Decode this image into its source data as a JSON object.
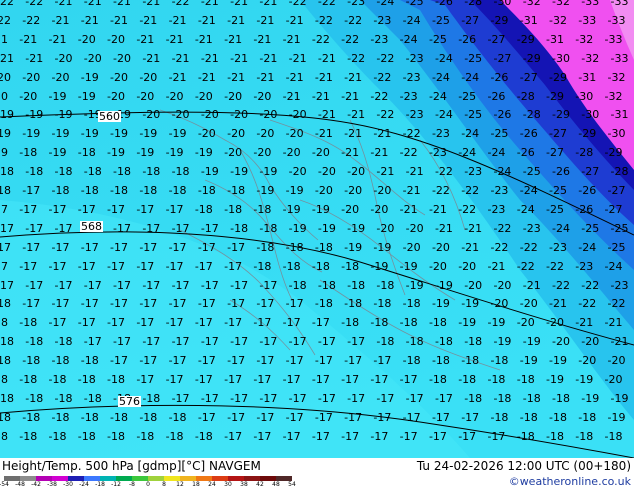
{
  "map": {
    "contour_labels": [
      "560",
      "568",
      "576"
    ],
    "temperature_field_rows": [
      "-22 -22 -21 -21 -21 -21 -22 -21 -21 -21 -22 -22 -23 -24 -25 -26 -28 -30 -32 -32 -33 -33 -34 -35",
      "-22 -22 -21 -21 -21 -21 -21 -21 -21 -21 -21 -22 -22 -23 -24 -25 -27 -29 -31 -32 -33 -33 -33 -34",
      "-21 -21 -21 -20 -20 -21 -21 -21 -21 -21 -21 -22 -22 -23 -24 -25 -26 -27 -29 -31 -32 -33 -33 -34",
      "-21 -21 -20 -20 -20 -21 -21 -21 -21 -21 -21 -21 -22 -22 -23 -24 -25 -27 -29 -30 -32 -33 -33 -33",
      "-20 -20 -20 -19 -20 -20 -21 -21 -21 -21 -21 -21 -21 -22 -23 -24 -24 -26 -27 -29 -31 -32 -32 -33",
      "-20 -20 -19 -19 -20 -20 -20 -20 -20 -20 -21 -21 -21 -22 -23 -24 -25 -26 -28 -29 -30 -32 -32 -33",
      "-19 -19 -19 -19 -19 -20 -20 -20 -20 -20 -20 -21 -21 -22 -23 -24 -25 -26 -28 -29 -30 -31 -32 -33",
      "-19 -19 -19 -19 -19 -19 -19 -20 -20 -20 -20 -21 -21 -21 -22 -23 -24 -25 -26 -27 -29 -30 -30 -31",
      "-19 -18 -19 -18 -19 -19 -19 -19 -20 -20 -20 -20 -21 -21 -22 -23 -24 -24 -26 -27 -28 -29 -30 -31",
      "-18 -18 -18 -18 -18 -18 -18 -19 -19 -19 -20 -20 -20 -21 -21 -22 -23 -24 -25 -26 -27 -28 -29 -30",
      "-18 -17 -18 -18 -18 -18 -18 -18 -18 -19 -19 -20 -20 -20 -21 -22 -22 -23 -24 -25 -26 -27 -28 -29",
      "-17 -17 -17 -17 -17 -17 -17 -18 -18 -18 -19 -19 -20 -20 -21 -21 -22 -23 -24 -25 -26 -27 -28 -28",
      "-17 -17 -17 -17 -17 -17 -17 -17 -18 -18 -19 -19 -19 -20 -20 -21 -21 -22 -23 -24 -25 -25 -26 -27",
      "-17 -17 -17 -17 -17 -17 -17 -17 -17 -18 -18 -18 -19 -19 -20 -20 -21 -22 -22 -23 -24 -25 -25 -26",
      "-17 -17 -17 -17 -17 -17 -17 -17 -17 -18 -18 -18 -18 -19 -19 -20 -20 -21 -22 -22 -23 -24 -24 -25",
      "-17 -17 -17 -17 -17 -17 -17 -17 -17 -17 -18 -18 -18 -18 -19 -19 -20 -20 -21 -22 -22 -23 -24 -24",
      "-18 -17 -17 -17 -17 -17 -17 -17 -17 -17 -17 -18 -18 -18 -18 -19 -19 -20 -20 -21 -22 -22 -23 -23",
      "-18 -18 -17 -17 -17 -17 -17 -17 -17 -17 -17 -17 -18 -18 -18 -18 -19 -19 -20 -20 -21 -21 -22 -22",
      "-18 -18 -18 -17 -17 -17 -17 -17 -17 -17 -17 -17 -17 -18 -18 -18 -18 -19 -19 -20 -20 -21 -21 -22",
      "-18 -18 -18 -18 -17 -17 -17 -17 -17 -17 -17 -17 -17 -17 -18 -18 -18 -18 -19 -19 -20 -20 -21 -21",
      "-18 -18 -18 -18 -18 -17 -17 -17 -17 -17 -17 -17 -17 -17 -17 -18 -18 -18 -18 -19 -19 -20 -20 -21",
      "-18 -18 -18 -18 -18 -18 -17 -17 -17 -17 -17 -17 -17 -17 -17 -17 -18 -18 -18 -18 -19 -19 -20 -20",
      "-18 -18 -18 -18 -18 -18 -18 -17 -17 -17 -17 -17 -17 -17 -17 -17 -17 -18 -18 -18 -18 -19 -19 -20",
      "-18 -18 -18 -18 -18 -18 -18 -18 -17 -17 -17 -17 -17 -17 -17 -17 -17 -17 -18 -18 -18 -18 -19 -19"
    ]
  },
  "footer": {
    "title": "Height/Temp. 500 hPa [gdmp][°C] NAVGEM",
    "valid_time": "Tu 24-02-2026 12:00 UTC (00+180)",
    "credit": "©weatheronline.co.uk",
    "legend": {
      "ticks": [
        "-54",
        "-48",
        "-42",
        "-38",
        "-30",
        "-24",
        "-18",
        "-12",
        "-8",
        "0",
        "8",
        "12",
        "18",
        "24",
        "30",
        "38",
        "42",
        "48",
        "54"
      ],
      "colors": [
        "#6e6e6e",
        "#8c8c8c",
        "#b400b4",
        "#d200d2",
        "#1e1eb4",
        "#3c78ff",
        "#00b4b4",
        "#00aa50",
        "#3cc83c",
        "#a0d23c",
        "#f0e61e",
        "#f0b41e",
        "#f07814",
        "#dc3c14",
        "#b41414",
        "#8c1414",
        "#6e0a0a",
        "#502828"
      ]
    }
  }
}
